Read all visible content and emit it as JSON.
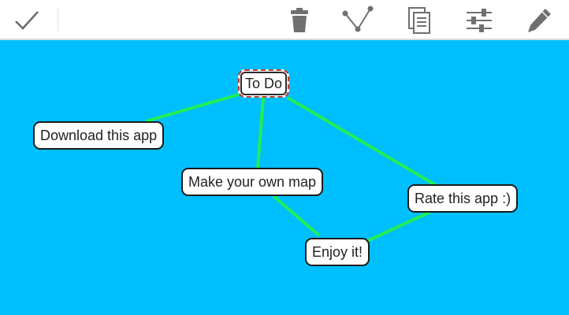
{
  "toolbar": {
    "accent_color": "#00bfff",
    "buttons": [
      {
        "id": "done",
        "icon": "checkmark-icon"
      },
      {
        "id": "delete",
        "icon": "trash-icon"
      },
      {
        "id": "connect",
        "icon": "connect-nodes-icon"
      },
      {
        "id": "copy",
        "icon": "copy-icon"
      },
      {
        "id": "settings",
        "icon": "sliders-icon"
      },
      {
        "id": "edit",
        "icon": "pencil-icon"
      }
    ]
  },
  "map": {
    "background_color": "#00bfff",
    "edge_color": "#22ee55",
    "selected_node": "To Do",
    "nodes": [
      {
        "id": "todo",
        "label": "To Do"
      },
      {
        "id": "download",
        "label": "Download this app"
      },
      {
        "id": "make",
        "label": "Make your own map"
      },
      {
        "id": "rate",
        "label": "Rate this app :)"
      },
      {
        "id": "enjoy",
        "label": "Enjoy it!"
      }
    ],
    "edges": [
      [
        "todo",
        "download"
      ],
      [
        "todo",
        "make"
      ],
      [
        "todo",
        "rate"
      ],
      [
        "make",
        "enjoy"
      ],
      [
        "rate",
        "enjoy"
      ]
    ]
  }
}
